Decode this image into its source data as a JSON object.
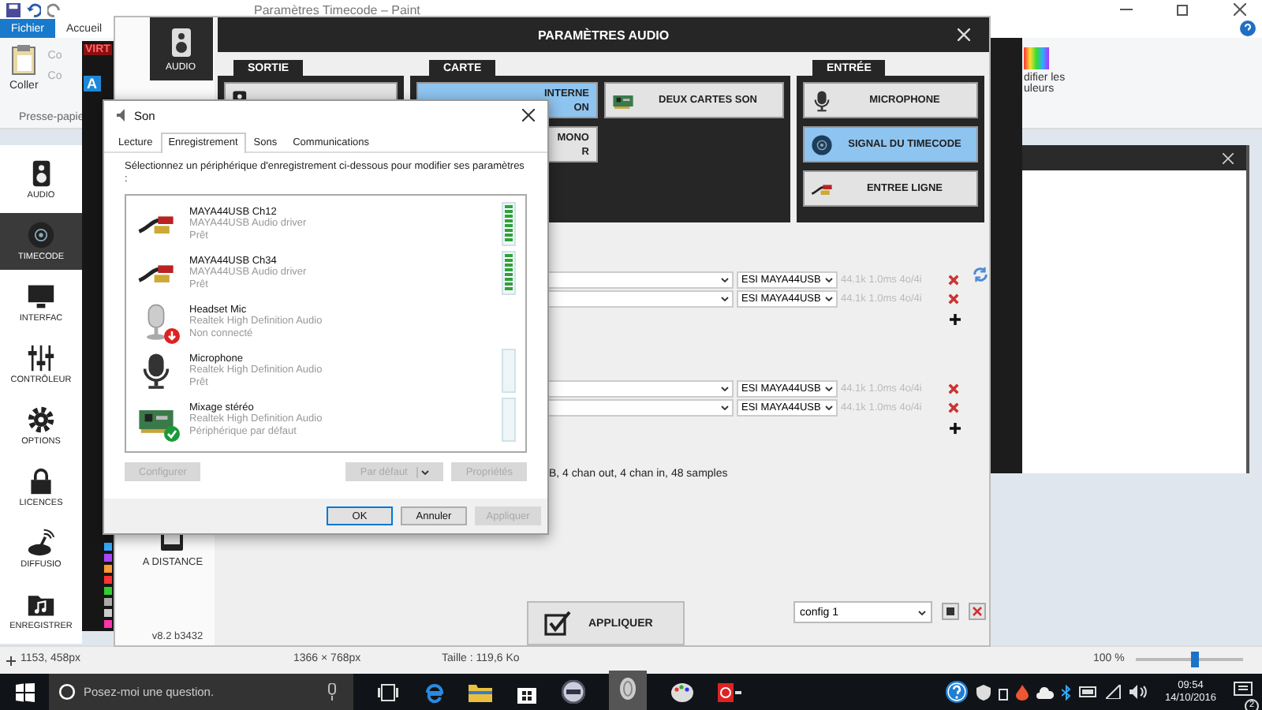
{
  "paint": {
    "title": "Paramètres Timecode – Paint",
    "tabs": [
      {
        "label": "Fichier",
        "selected": true
      },
      {
        "label": "Accueil",
        "selected": false
      }
    ],
    "paste_label": "Coller",
    "cut_label": "Co",
    "copy_label": "Co",
    "group_label": "Presse-papie",
    "colors_lines": [
      "difier les",
      "uleurs"
    ],
    "status": {
      "cursor": "1153, 458px",
      "dimensions": "1366 × 768px",
      "file_size": "Taille : 119,6 Ko",
      "zoom": "100 %"
    },
    "zoom_slider": {
      "level": 0.55
    }
  },
  "back_app": {
    "logo": "VIRT",
    "badge": "A",
    "sidebar": [
      {
        "label": "AUDIO",
        "kind": "speaker",
        "selected": false
      },
      {
        "label": "TIMECODE",
        "kind": "disc",
        "selected": true
      },
      {
        "label": "INTERFAC",
        "kind": "monitor",
        "selected": false
      },
      {
        "label": "CONTRÔLEUR",
        "kind": "sliders",
        "selected": false
      },
      {
        "label": "OPTIONS",
        "kind": "gear",
        "selected": false
      },
      {
        "label": "LICENCES",
        "kind": "lock",
        "selected": false
      },
      {
        "label": "DIFFUSIO",
        "kind": "broadcast",
        "selected": false
      },
      {
        "label": "ENREGISTRER",
        "kind": "folder",
        "selected": false
      }
    ]
  },
  "settings": {
    "title": "PARAMÈTRES AUDIO",
    "nav_label": "AUDIO",
    "remote_label": "A DISTANCE",
    "version": "v8.2 b3432",
    "groups": [
      {
        "title": "SORTIE",
        "buttons": [
          {
            "kind": "speaker",
            "selected": false
          }
        ]
      },
      {
        "title": "CARTE",
        "buttons": [
          {
            "lines": [
              "INTERNE",
              "ON"
            ],
            "kind": "none",
            "selected": true
          },
          {
            "lines": [
              "DEUX CARTES SON"
            ],
            "kind": "card",
            "selected": false
          },
          {
            "lines": [
              "MONO",
              "R"
            ],
            "kind": "none",
            "selected": false
          }
        ]
      },
      {
        "title": "ENTRÉE",
        "buttons": [
          {
            "lines": [
              "MICROPHONE"
            ],
            "kind": "mic",
            "selected": false
          },
          {
            "lines": [
              "SIGNAL DU TIMECODE"
            ],
            "kind": "disc",
            "selected": true
          },
          {
            "lines": [
              "ENTREE LIGNE"
            ],
            "kind": "cable",
            "selected": false
          }
        ]
      }
    ],
    "sections": [
      {
        "rows": [
          {
            "device": "ESI MAYA44USB",
            "info": "44.1k 1.0ms 4o/4i"
          },
          {
            "device": "ESI MAYA44USB",
            "info": "44.1k 1.0ms 4o/4i"
          }
        ]
      },
      {
        "rows": [
          {
            "device": "ESI MAYA44USB",
            "info": "44.1k 1.0ms 4o/4i"
          },
          {
            "device": "ESI MAYA44USB",
            "info": "44.1k 1.0ms 4o/4i"
          }
        ]
      }
    ],
    "summary": "B, 4 chan out, 4 chan in, 48 samples",
    "apply_label": "APPLIQUER",
    "config": "config 1"
  },
  "dialog": {
    "title": "Son",
    "tabs": [
      {
        "label": "Lecture",
        "selected": false
      },
      {
        "label": "Enregistrement",
        "selected": true
      },
      {
        "label": "Sons",
        "selected": false
      },
      {
        "label": "Communications",
        "selected": false
      }
    ],
    "instruction": "Sélectionnez un périphérique d'enregistrement ci-dessous pour modifier ses paramètres :",
    "devices": [
      {
        "name": "MAYA44USB Ch12",
        "driver": "MAYA44USB Audio driver",
        "status": "Prêt",
        "kind": "cable",
        "disconnected": false,
        "default": false,
        "level": 1
      },
      {
        "name": "MAYA44USB Ch34",
        "driver": "MAYA44USB Audio driver",
        "status": "Prêt",
        "kind": "cable",
        "disconnected": false,
        "default": false,
        "level": 1
      },
      {
        "name": "Headset Mic",
        "driver": "Realtek High Definition Audio",
        "status": "Non connecté",
        "kind": "headset",
        "disconnected": true,
        "default": false
      },
      {
        "name": "Microphone",
        "driver": "Realtek High Definition Audio",
        "status": "Prêt",
        "kind": "mic",
        "disconnected": false,
        "default": false,
        "level": 0
      },
      {
        "name": "Mixage stéréo",
        "driver": "Realtek High Definition Audio",
        "status": "Périphérique par défaut",
        "kind": "card",
        "disconnected": false,
        "default": true,
        "level": 0
      }
    ],
    "configure": {
      "label": "Configurer",
      "disabled": true
    },
    "actions": [
      {
        "label": "Par défaut",
        "kind": "split",
        "disabled": true
      },
      {
        "label": "Propriétés",
        "kind": "plain",
        "disabled": true
      }
    ],
    "footer": [
      {
        "label": "OK",
        "disabled": false,
        "focused": true
      },
      {
        "label": "Annuler",
        "disabled": false,
        "focused": false
      },
      {
        "label": "Appliquer",
        "disabled": true,
        "focused": false
      }
    ]
  },
  "taskbar": {
    "search_placeholder": "Posez-moi une question.",
    "time": "09:54",
    "date": "14/10/2016",
    "notifications": "2"
  }
}
